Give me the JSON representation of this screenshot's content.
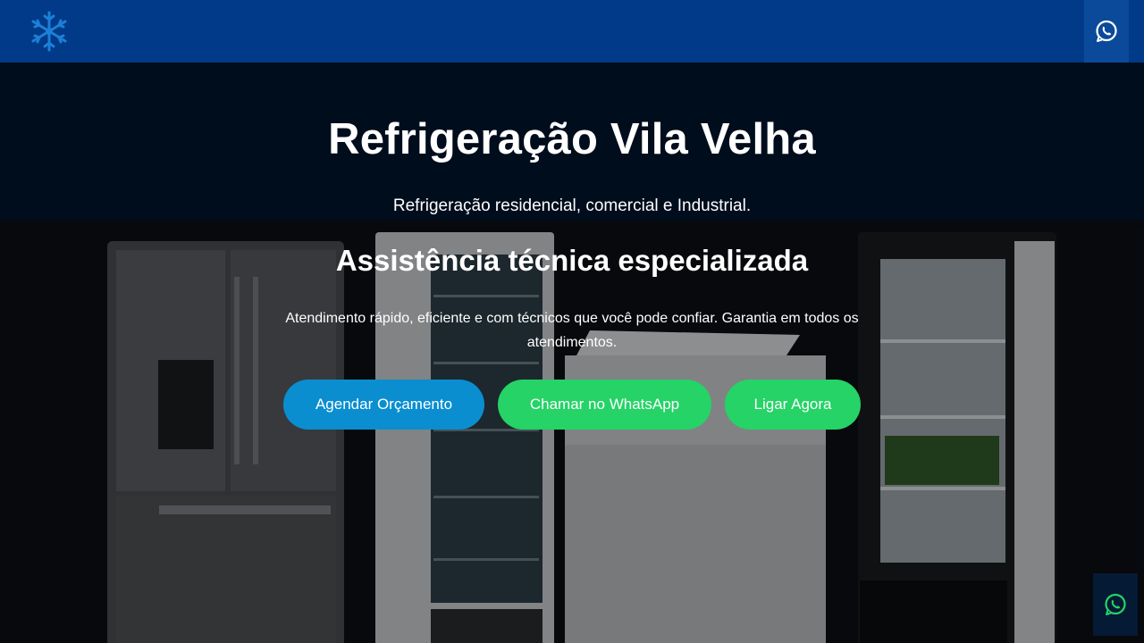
{
  "header": {
    "logo_icon": "snowflake-logo-icon",
    "whatsapp_icon": "whatsapp-icon"
  },
  "hero": {
    "title": "Refrigeração Vila Velha",
    "subtitle": "Refrigeração residencial, comercial e Industrial.",
    "heading": "Assistência técnica especializada",
    "description": "Atendimento rápido, eficiente e com técnicos que você pode confiar. Garantia em todos os atendimentos.",
    "buttons": {
      "schedule": "Agendar Orçamento",
      "whatsapp": "Chamar no WhatsApp",
      "call": "Ligar Agora"
    }
  },
  "floating": {
    "whatsapp_icon": "whatsapp-icon"
  },
  "colors": {
    "header_bg": "#003a88",
    "hero_bg": "#000d1c",
    "primary_button": "#0a8ed0",
    "whatsapp_green": "#25d366"
  }
}
